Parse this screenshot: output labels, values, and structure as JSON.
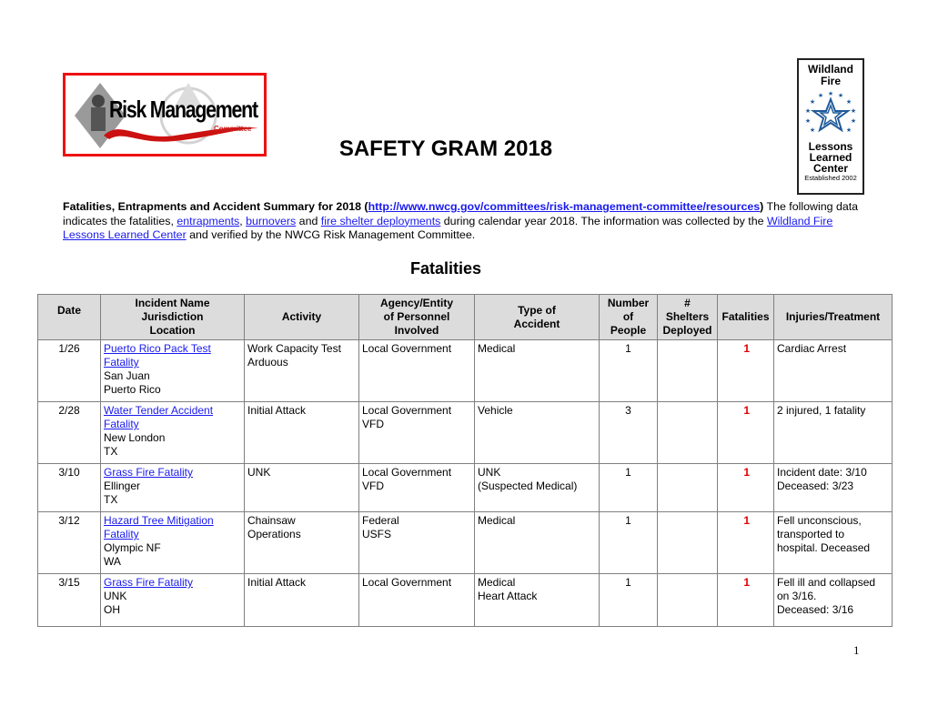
{
  "header": {
    "rm_logo": {
      "title": "Risk Management",
      "subtitle": "Committee"
    },
    "llc_logo": {
      "line1": "Wildland",
      "line2": "Fire",
      "line3": "Lessons",
      "line4": "Learned",
      "line5": "Center",
      "established": "Established 2002"
    },
    "title": "SAFETY GRAM 2018"
  },
  "intro": {
    "bold_lead": "Fatalities, Entrapments and Accident Summary for 2018 (",
    "url_link": "http://www.nwcg.gov/committees/risk-management-committee/resources",
    "bold_close": ")",
    "text1": " The following data indicates the fatalities, ",
    "link_entrapments": "entrapments",
    "comma": ", ",
    "link_burnovers": "burnovers",
    "text2": " and ",
    "link_shelter": "fire shelter deployments",
    "text3": " during calendar year 2018. The information was collected by the ",
    "link_llc": "Wildland Fire Lessons Learned Center",
    "text4": " and verified by the NWCG Risk Management Committee."
  },
  "section_title": "Fatalities",
  "table": {
    "headers": [
      [
        "Date"
      ],
      [
        "Incident Name",
        "Jurisdiction",
        "Location"
      ],
      [
        "Activity"
      ],
      [
        "Agency/Entity",
        "of Personnel",
        "Involved"
      ],
      [
        "Type of",
        "Accident"
      ],
      [
        "Number",
        "of",
        "People"
      ],
      [
        "#",
        "Shelters",
        "Deployed"
      ],
      [
        "Fatalities"
      ],
      [
        "Injuries/Treatment"
      ]
    ],
    "rows": [
      {
        "date": "1/26",
        "incident_link": "Puerto Rico Pack Test Fatality",
        "jurisdiction": "San Juan",
        "location": "Puerto Rico",
        "activity": [
          "Work Capacity Test",
          "Arduous"
        ],
        "agency": [
          "Local Government"
        ],
        "type": [
          "Medical"
        ],
        "people": "1",
        "shelters": "",
        "fatalities": "1",
        "injuries": [
          "Cardiac Arrest"
        ]
      },
      {
        "date": "2/28",
        "incident_link": "Water Tender Accident Fatality",
        "jurisdiction": "New London",
        "location": "TX",
        "activity": [
          "Initial Attack"
        ],
        "agency": [
          "Local Government",
          "VFD"
        ],
        "type": [
          "Vehicle"
        ],
        "people": "3",
        "shelters": "",
        "fatalities": "1",
        "injuries": [
          "2 injured, 1 fatality"
        ]
      },
      {
        "date": "3/10",
        "incident_link": "Grass Fire Fatality",
        "jurisdiction": "Ellinger",
        "location": "TX",
        "activity": [
          "UNK"
        ],
        "agency": [
          "Local Government",
          "VFD"
        ],
        "type": [
          "UNK",
          "(Suspected Medical)"
        ],
        "people": "1",
        "shelters": "",
        "fatalities": "1",
        "injuries": [
          "Incident date: 3/10",
          "Deceased: 3/23"
        ]
      },
      {
        "date": "3/12",
        "incident_link": "Hazard Tree Mitigation Fatality",
        "jurisdiction": "Olympic NF",
        "location": "WA",
        "activity": [
          "Chainsaw",
          "Operations"
        ],
        "agency": [
          "Federal",
          "USFS"
        ],
        "type": [
          "Medical"
        ],
        "people": "1",
        "shelters": "",
        "fatalities": "1",
        "injuries": [
          "Fell unconscious,",
          "transported to",
          "hospital. Deceased"
        ]
      },
      {
        "date": "3/15",
        "incident_link": "Grass Fire Fatality",
        "jurisdiction": "UNK",
        "location": "OH",
        "activity": [
          "Initial Attack"
        ],
        "agency": [
          "Local Government"
        ],
        "type": [
          "Medical",
          "Heart Attack"
        ],
        "people": "1",
        "shelters": "",
        "fatalities": "1",
        "injuries": [
          "Fell ill and collapsed",
          "on 3/16.",
          "Deceased: 3/16"
        ]
      }
    ]
  },
  "page_number": "1"
}
